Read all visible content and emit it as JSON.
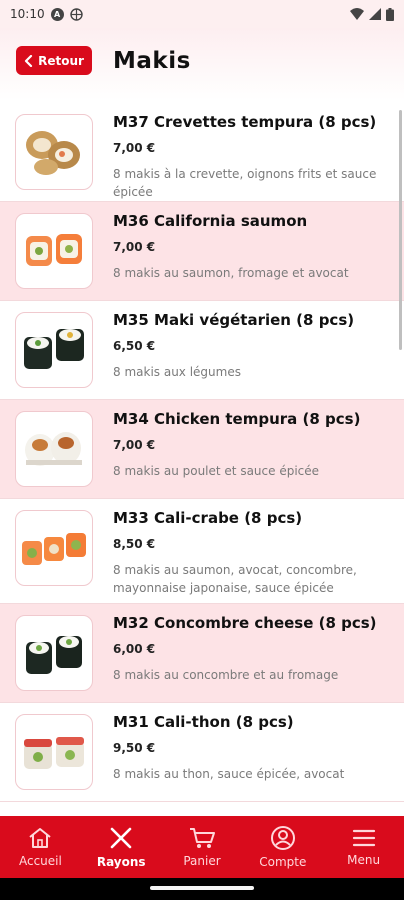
{
  "status": {
    "time": "10:10",
    "icons": [
      "a-circle-icon",
      "globe-icon",
      "wifi-icon",
      "signal-icon",
      "battery-icon"
    ]
  },
  "header": {
    "back_label": "Retour",
    "title": "Makis"
  },
  "items": [
    {
      "title": "M37 Crevettes tempura (8 pcs)",
      "price": "7,00 €",
      "desc": "8 makis à la crevette, oignons frits et sauce épicée",
      "image": "tempura-shrimp-maki"
    },
    {
      "title": "M36 California saumon",
      "price": "7,00 €",
      "desc": "8 makis au saumon, fromage et avocat",
      "image": "salmon-california-maki"
    },
    {
      "title": "M35 Maki végétarien (8 pcs)",
      "price": "6,50 €",
      "desc": "8 makis aux légumes",
      "image": "vegetable-maki"
    },
    {
      "title": "M34 Chicken tempura (8 pcs)",
      "price": "7,00 €",
      "desc": "8 makis au poulet et sauce épicée",
      "image": "chicken-tempura-maki"
    },
    {
      "title": "M33 Cali-crabe (8 pcs)",
      "price": "8,50 €",
      "desc": "8 makis au saumon, avocat, concombre, mayonnaise japonaise, sauce épicée",
      "image": "crab-california-maki"
    },
    {
      "title": "M32 Concombre cheese (8 pcs)",
      "price": "6,00 €",
      "desc": "8 makis au concombre et au fromage",
      "image": "cucumber-cheese-maki"
    },
    {
      "title": "M31 Cali-thon (8 pcs)",
      "price": "9,50 €",
      "desc": "8 makis au thon, sauce épicée, avocat",
      "image": "tuna-california-maki"
    }
  ],
  "tabs": [
    {
      "label": "Accueil",
      "icon": "home-icon",
      "active": false
    },
    {
      "label": "Rayons",
      "icon": "utensils-icon",
      "active": true
    },
    {
      "label": "Panier",
      "icon": "cart-icon",
      "active": false
    },
    {
      "label": "Compte",
      "icon": "account-icon",
      "active": false
    },
    {
      "label": "Menu",
      "icon": "menu-icon",
      "active": false
    }
  ],
  "colors": {
    "brand_red": "#d90b1c",
    "row_highlight": "#fde3e6"
  }
}
